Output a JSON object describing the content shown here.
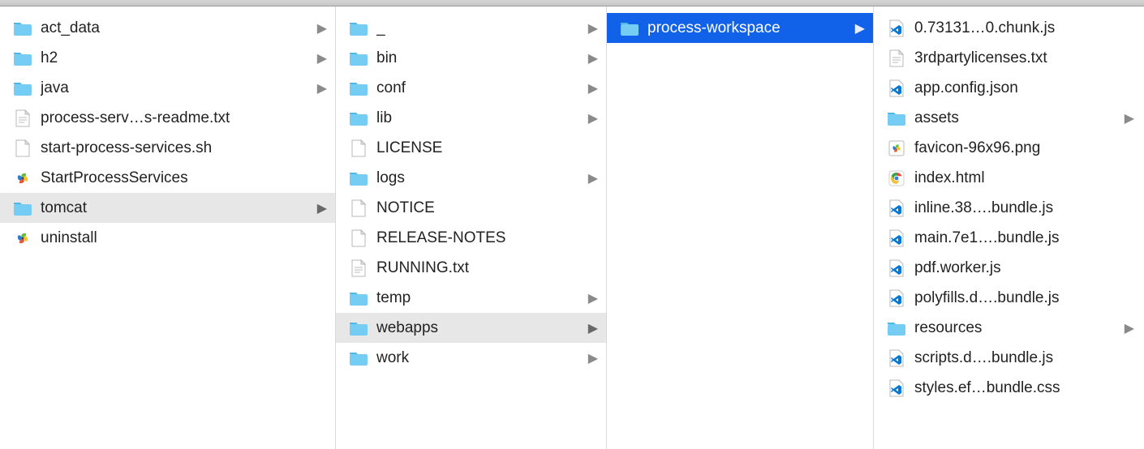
{
  "columns": [
    {
      "items": [
        {
          "type": "folder",
          "label": "act_data",
          "hasChildren": true
        },
        {
          "type": "folder",
          "label": "h2",
          "hasChildren": true
        },
        {
          "type": "folder",
          "label": "java",
          "hasChildren": true
        },
        {
          "type": "txt",
          "label": "process-serv…s-readme.txt"
        },
        {
          "type": "file",
          "label": "start-process-services.sh"
        },
        {
          "type": "app",
          "label": "StartProcessServices"
        },
        {
          "type": "folder",
          "label": "tomcat",
          "hasChildren": true,
          "state": "expanded"
        },
        {
          "type": "app",
          "label": "uninstall"
        }
      ]
    },
    {
      "items": [
        {
          "type": "folder",
          "label": "_",
          "hasChildren": true
        },
        {
          "type": "folder",
          "label": "bin",
          "hasChildren": true
        },
        {
          "type": "folder",
          "label": "conf",
          "hasChildren": true
        },
        {
          "type": "folder",
          "label": "lib",
          "hasChildren": true
        },
        {
          "type": "file",
          "label": "LICENSE"
        },
        {
          "type": "folder",
          "label": "logs",
          "hasChildren": true
        },
        {
          "type": "file",
          "label": "NOTICE"
        },
        {
          "type": "file",
          "label": "RELEASE-NOTES"
        },
        {
          "type": "txt",
          "label": "RUNNING.txt"
        },
        {
          "type": "folder",
          "label": "temp",
          "hasChildren": true
        },
        {
          "type": "folder",
          "label": "webapps",
          "hasChildren": true,
          "state": "expanded"
        },
        {
          "type": "folder",
          "label": "work",
          "hasChildren": true
        }
      ]
    },
    {
      "items": [
        {
          "type": "folder",
          "label": "process-workspace",
          "hasChildren": true,
          "state": "selected"
        }
      ]
    },
    {
      "items": [
        {
          "type": "vscode",
          "label": "0.73131…0.chunk.js"
        },
        {
          "type": "txt",
          "label": "3rdpartylicenses.txt"
        },
        {
          "type": "vscode",
          "label": "app.config.json"
        },
        {
          "type": "folder",
          "label": "assets",
          "hasChildren": true
        },
        {
          "type": "png",
          "label": "favicon-96x96.png"
        },
        {
          "type": "chrome",
          "label": "index.html"
        },
        {
          "type": "vscode",
          "label": "inline.38….bundle.js"
        },
        {
          "type": "vscode",
          "label": "main.7e1….bundle.js"
        },
        {
          "type": "vscode",
          "label": "pdf.worker.js"
        },
        {
          "type": "vscode",
          "label": "polyfills.d….bundle.js"
        },
        {
          "type": "folder",
          "label": "resources",
          "hasChildren": true
        },
        {
          "type": "vscode",
          "label": "scripts.d….bundle.js"
        },
        {
          "type": "vscode",
          "label": "styles.ef…bundle.css"
        }
      ]
    }
  ]
}
